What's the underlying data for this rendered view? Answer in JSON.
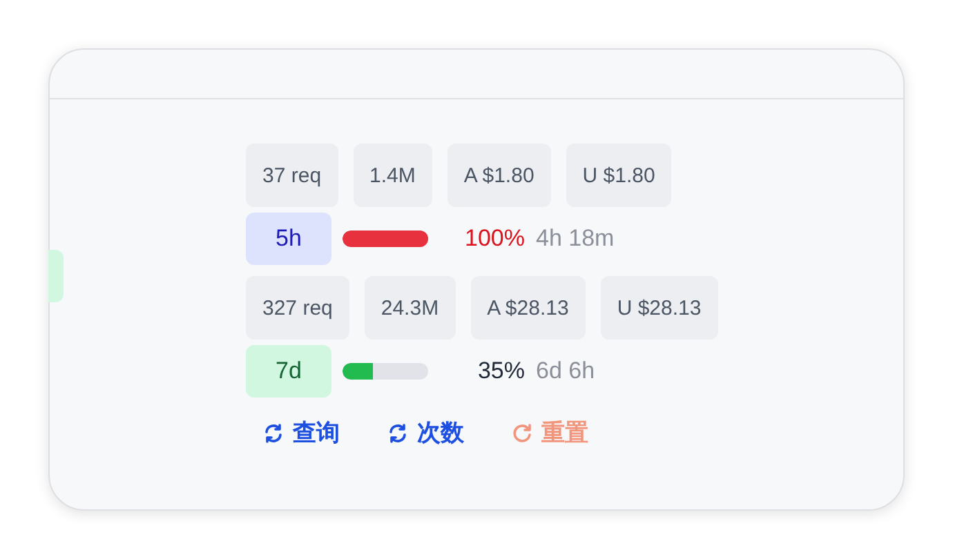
{
  "groups": [
    {
      "stats": [
        "37 req",
        "1.4M",
        "A $1.80",
        "U $1.80"
      ],
      "window": {
        "label": "5h",
        "color": "#dde3fd",
        "kind": "critical",
        "level": 1.0,
        "percent": "100%",
        "remaining": "4h 18m"
      }
    },
    {
      "stats": [
        "327 req",
        "24.3M",
        "A $28.13",
        "U $28.13"
      ],
      "window": {
        "label": "7d",
        "color": "#d1f7e0",
        "kind": "normal",
        "level": 0.35,
        "percent": "35%",
        "remaining": "6d 6h"
      }
    }
  ],
  "actions": [
    {
      "label": "查询",
      "kind": "primary"
    },
    {
      "label": "次数",
      "kind": "primary"
    },
    {
      "label": "重置",
      "kind": "danger"
    }
  ]
}
